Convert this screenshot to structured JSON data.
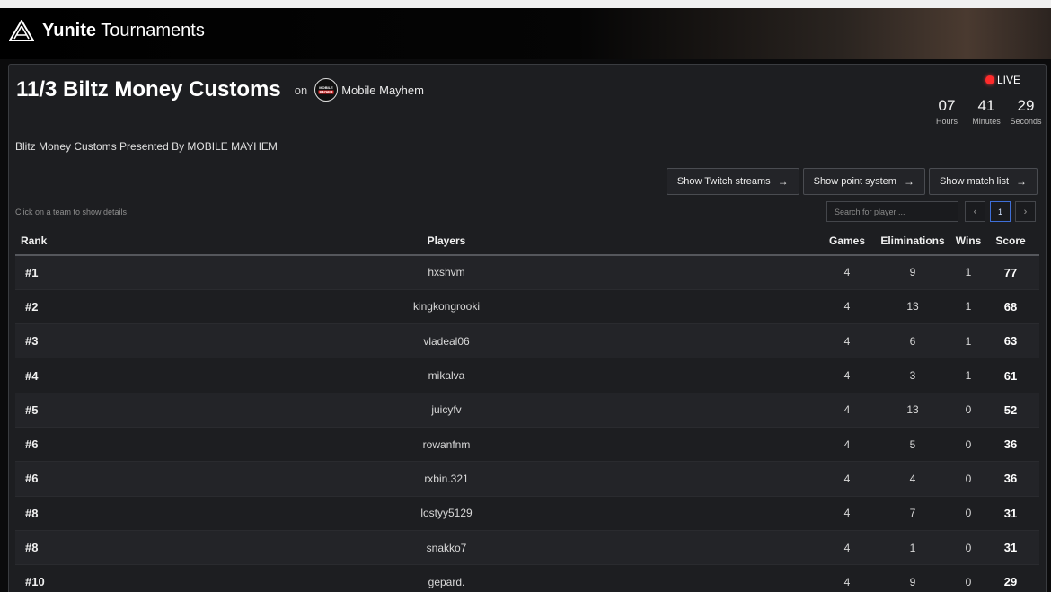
{
  "brand": {
    "name_bold": "Yunite",
    "name_rest": " Tournaments"
  },
  "tournament": {
    "title": "11/3 Biltz Money Customs",
    "on_label": "on",
    "organizer": "Mobile Mayhem",
    "organizer_logo_text": "MOBILE MAYHEM",
    "subtitle": "Blitz Money Customs Presented By MOBILE MAYHEM"
  },
  "live": {
    "label": "LIVE",
    "hours": "07",
    "hours_label": "Hours",
    "minutes": "41",
    "minutes_label": "Minutes",
    "seconds": "29",
    "seconds_label": "Seconds"
  },
  "buttons": {
    "twitch": "Show Twitch streams",
    "points": "Show point system",
    "matches": "Show match list"
  },
  "hint": "Click on a team to show details",
  "search": {
    "placeholder": "Search for player ..."
  },
  "pagination": {
    "prev": "‹",
    "current": "1",
    "next": "›"
  },
  "table": {
    "headers": {
      "rank": "Rank",
      "players": "Players",
      "games": "Games",
      "eliminations": "Eliminations",
      "wins": "Wins",
      "score": "Score"
    },
    "rows": [
      {
        "rank": "#1",
        "player": "hxshvm",
        "games": "4",
        "eliminations": "9",
        "wins": "1",
        "score": "77"
      },
      {
        "rank": "#2",
        "player": "kingkongrooki",
        "games": "4",
        "eliminations": "13",
        "wins": "1",
        "score": "68"
      },
      {
        "rank": "#3",
        "player": "vladeal06",
        "games": "4",
        "eliminations": "6",
        "wins": "1",
        "score": "63"
      },
      {
        "rank": "#4",
        "player": "mikalva",
        "games": "4",
        "eliminations": "3",
        "wins": "1",
        "score": "61"
      },
      {
        "rank": "#5",
        "player": "juicyfv",
        "games": "4",
        "eliminations": "13",
        "wins": "0",
        "score": "52"
      },
      {
        "rank": "#6",
        "player": "rowanfnm",
        "games": "4",
        "eliminations": "5",
        "wins": "0",
        "score": "36"
      },
      {
        "rank": "#6",
        "player": "rxbin.321",
        "games": "4",
        "eliminations": "4",
        "wins": "0",
        "score": "36"
      },
      {
        "rank": "#8",
        "player": "lostyy5129",
        "games": "4",
        "eliminations": "7",
        "wins": "0",
        "score": "31"
      },
      {
        "rank": "#8",
        "player": "snakko7",
        "games": "4",
        "eliminations": "1",
        "wins": "0",
        "score": "31"
      },
      {
        "rank": "#10",
        "player": "gepard.",
        "games": "4",
        "eliminations": "9",
        "wins": "0",
        "score": "29"
      }
    ]
  }
}
